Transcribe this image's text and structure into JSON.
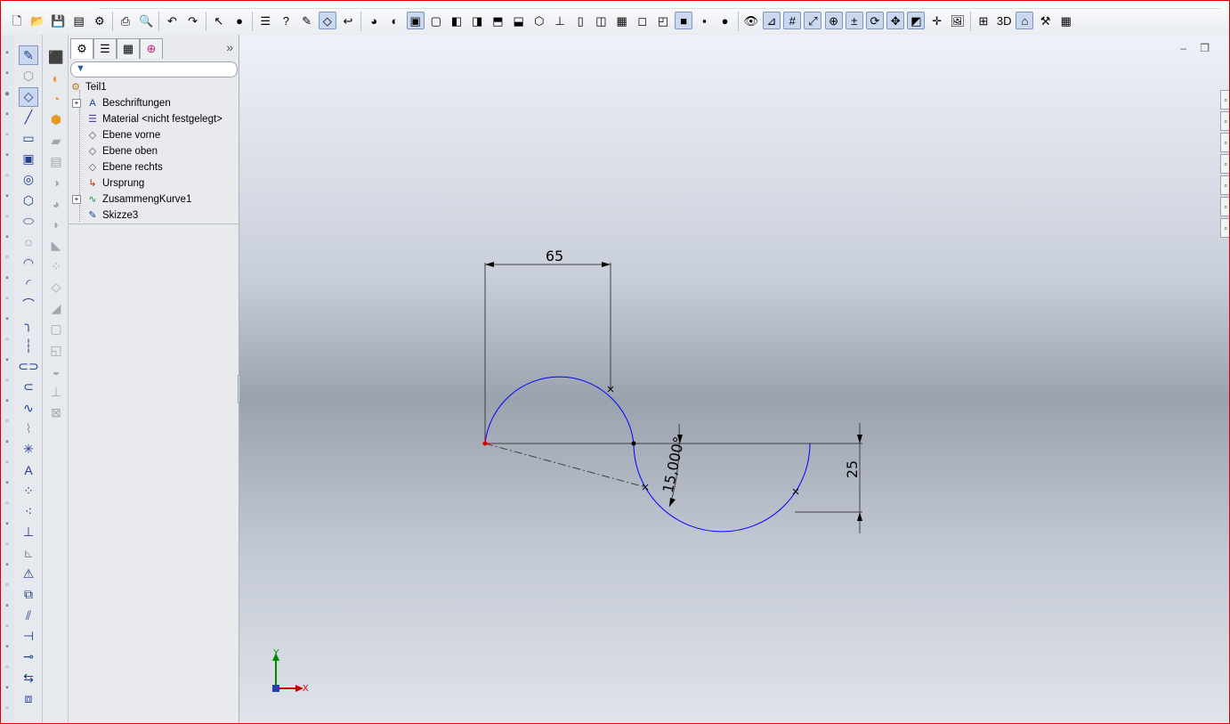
{
  "toolbar": {
    "buttons": [
      "new-document-icon",
      "open-icon",
      "save-icon",
      "make-drawing-icon",
      "make-assembly-icon",
      "print-icon",
      "print-preview-icon",
      "undo-icon",
      "redo-icon",
      "select-icon",
      "rebuild-icon",
      "file-properties-icon",
      "help-icon",
      "sketch-icon",
      "smart-dimension-icon",
      "exit-sketch-icon",
      "appearance-icon",
      "display-style-icon",
      "view-orientation-front-icon",
      "view-orientation-back-icon",
      "view-orientation-left-icon",
      "view-orientation-right-icon",
      "view-orientation-top-icon",
      "view-orientation-bottom-icon",
      "isometric-icon",
      "normal-to-icon",
      "single-view-icon",
      "two-view-icon",
      "four-view-icon",
      "wireframe-icon",
      "hidden-lines-visible-icon",
      "shaded-with-edges-icon",
      "shaded-icon",
      "realview-icon",
      "hide-show-items-icon",
      "sketch-relations-icon",
      "display-grid-icon",
      "zoom-to-fit-icon",
      "zoom-area-icon",
      "zoom-in-out-icon",
      "rotate-view-icon",
      "pan-icon",
      "section-view-icon",
      "point-icon",
      "render-icon",
      "add-in-icon",
      "3d-content-icon",
      "toolbox-icon",
      "options-icon",
      "customize-icon"
    ]
  },
  "feature_manager": {
    "tabs": [
      "feature-tree-tab",
      "property-manager-tab",
      "configuration-manager-tab",
      "dim-xpert-tab"
    ],
    "expand_label": "»",
    "tree": [
      {
        "label": "Teil1",
        "icon": "part-icon",
        "level": 0,
        "expandable": false
      },
      {
        "label": "Beschriftungen",
        "icon": "annotations-icon",
        "level": 1,
        "expandable": true
      },
      {
        "label": "Material <nicht festgelegt>",
        "icon": "material-icon",
        "level": 1,
        "expandable": false
      },
      {
        "label": "Ebene vorne",
        "icon": "plane-icon",
        "level": 1,
        "expandable": false
      },
      {
        "label": "Ebene oben",
        "icon": "plane-icon",
        "level": 1,
        "expandable": false
      },
      {
        "label": "Ebene rechts",
        "icon": "plane-icon",
        "level": 1,
        "expandable": false
      },
      {
        "label": "Ursprung",
        "icon": "origin-icon",
        "level": 1,
        "expandable": false
      },
      {
        "label": "ZusammengKurve1",
        "icon": "curve-icon",
        "level": 1,
        "expandable": true
      },
      {
        "label": "Skizze3",
        "icon": "sketch-icon",
        "level": 1,
        "expandable": false
      }
    ]
  },
  "sketch": {
    "dimensions": {
      "horizontal": "65",
      "vertical": "25",
      "angle": "15,000°"
    },
    "colors": {
      "sketch_curve": "#0000ff",
      "dimension_line": "#404040",
      "origin_point": "#dd0000"
    }
  },
  "triad": {
    "x_label": "X",
    "y_label": "Y",
    "x_color": "#cc0000",
    "y_color": "#008800"
  }
}
